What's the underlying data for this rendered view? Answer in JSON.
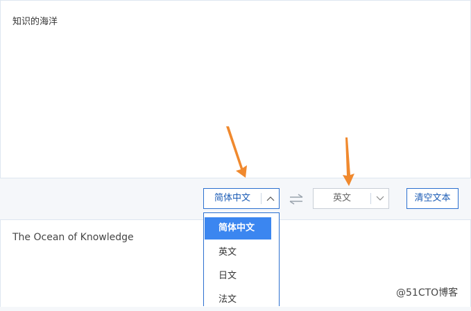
{
  "source_text": "知识的海洋",
  "target_text": "The Ocean of Knowledge",
  "toolbar": {
    "source_lang": "简体中文",
    "target_lang": "英文",
    "clear_label": "清空文本"
  },
  "dropdown": {
    "options": [
      "简体中文",
      "英文",
      "日文",
      "法文"
    ],
    "selected": "简体中文"
  },
  "watermark": "@51CTO博客",
  "colors": {
    "accent": "#2a6fcf",
    "selected_bg": "#3b86f0",
    "annotation_arrow": "#f0892e"
  }
}
